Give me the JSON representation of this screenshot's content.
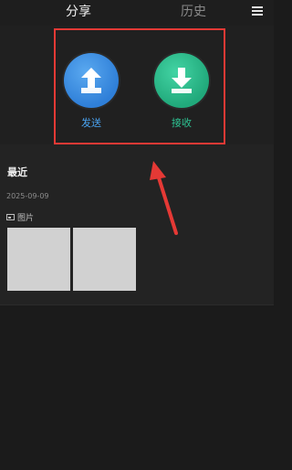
{
  "header": {
    "tabs": [
      {
        "label": "分享"
      },
      {
        "label": "历史"
      }
    ],
    "menu_icon": "menu-icon"
  },
  "actions": {
    "send": {
      "label": "发送",
      "icon": "upload-icon"
    },
    "receive": {
      "label": "接收",
      "icon": "download-icon"
    }
  },
  "recent": {
    "title": "最近",
    "date": "2025-09-09",
    "group_label": "图片",
    "images_count_visible": 2
  },
  "colors": {
    "highlight_border": "#e53935",
    "send_blue": "#2f7fd8",
    "receive_green": "#21a97b"
  }
}
